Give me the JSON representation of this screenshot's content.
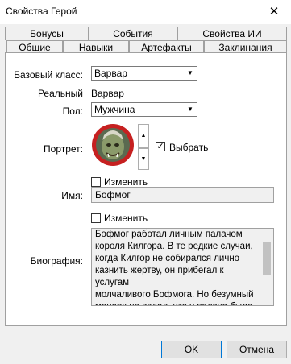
{
  "window": {
    "title": "Свойства Герой",
    "close_glyph": "✕"
  },
  "tabs_back": [
    "Бонусы",
    "События",
    "Свойства ИИ"
  ],
  "tabs_front": [
    "Общие",
    "Навыки",
    "Артефакты",
    "Заклинания"
  ],
  "form": {
    "base_class_label": "Базовый класс:",
    "base_class_value": "Варвар",
    "real_label": "Реальный",
    "real_value": "Варвар",
    "gender_label": "Пол:",
    "gender_value": "Мужчина",
    "portrait_label": "Портрет:",
    "select_checkbox_label": "Выбрать",
    "select_checkbox_checked": true,
    "name_change_label": "Изменить",
    "name_label": "Имя:",
    "name_value": "Бофмог",
    "bio_change_label": "Изменить",
    "bio_label": "Биография:",
    "bio_text": "Бофмог работал личным палачом\nкороля Килгора. В те редкие случаи,\nкогда Килгор не собирался лично\nказнить жертву, он прибегал к услугам\nмолчаливого Бофмога. Но безумный\nмонарх не ведал, что у палача было\nсвое мнение насчет того, кто должен"
  },
  "buttons": {
    "ok": "OK",
    "cancel": "Отмена"
  },
  "icons": {
    "dropdown": "dropdown-arrow-icon",
    "spin_up": "spin-up-icon",
    "spin_down": "spin-down-icon",
    "check": "check-icon",
    "close": "close-icon"
  },
  "colors": {
    "accent": "#0078d7",
    "portrait_ring": "#c62020"
  }
}
